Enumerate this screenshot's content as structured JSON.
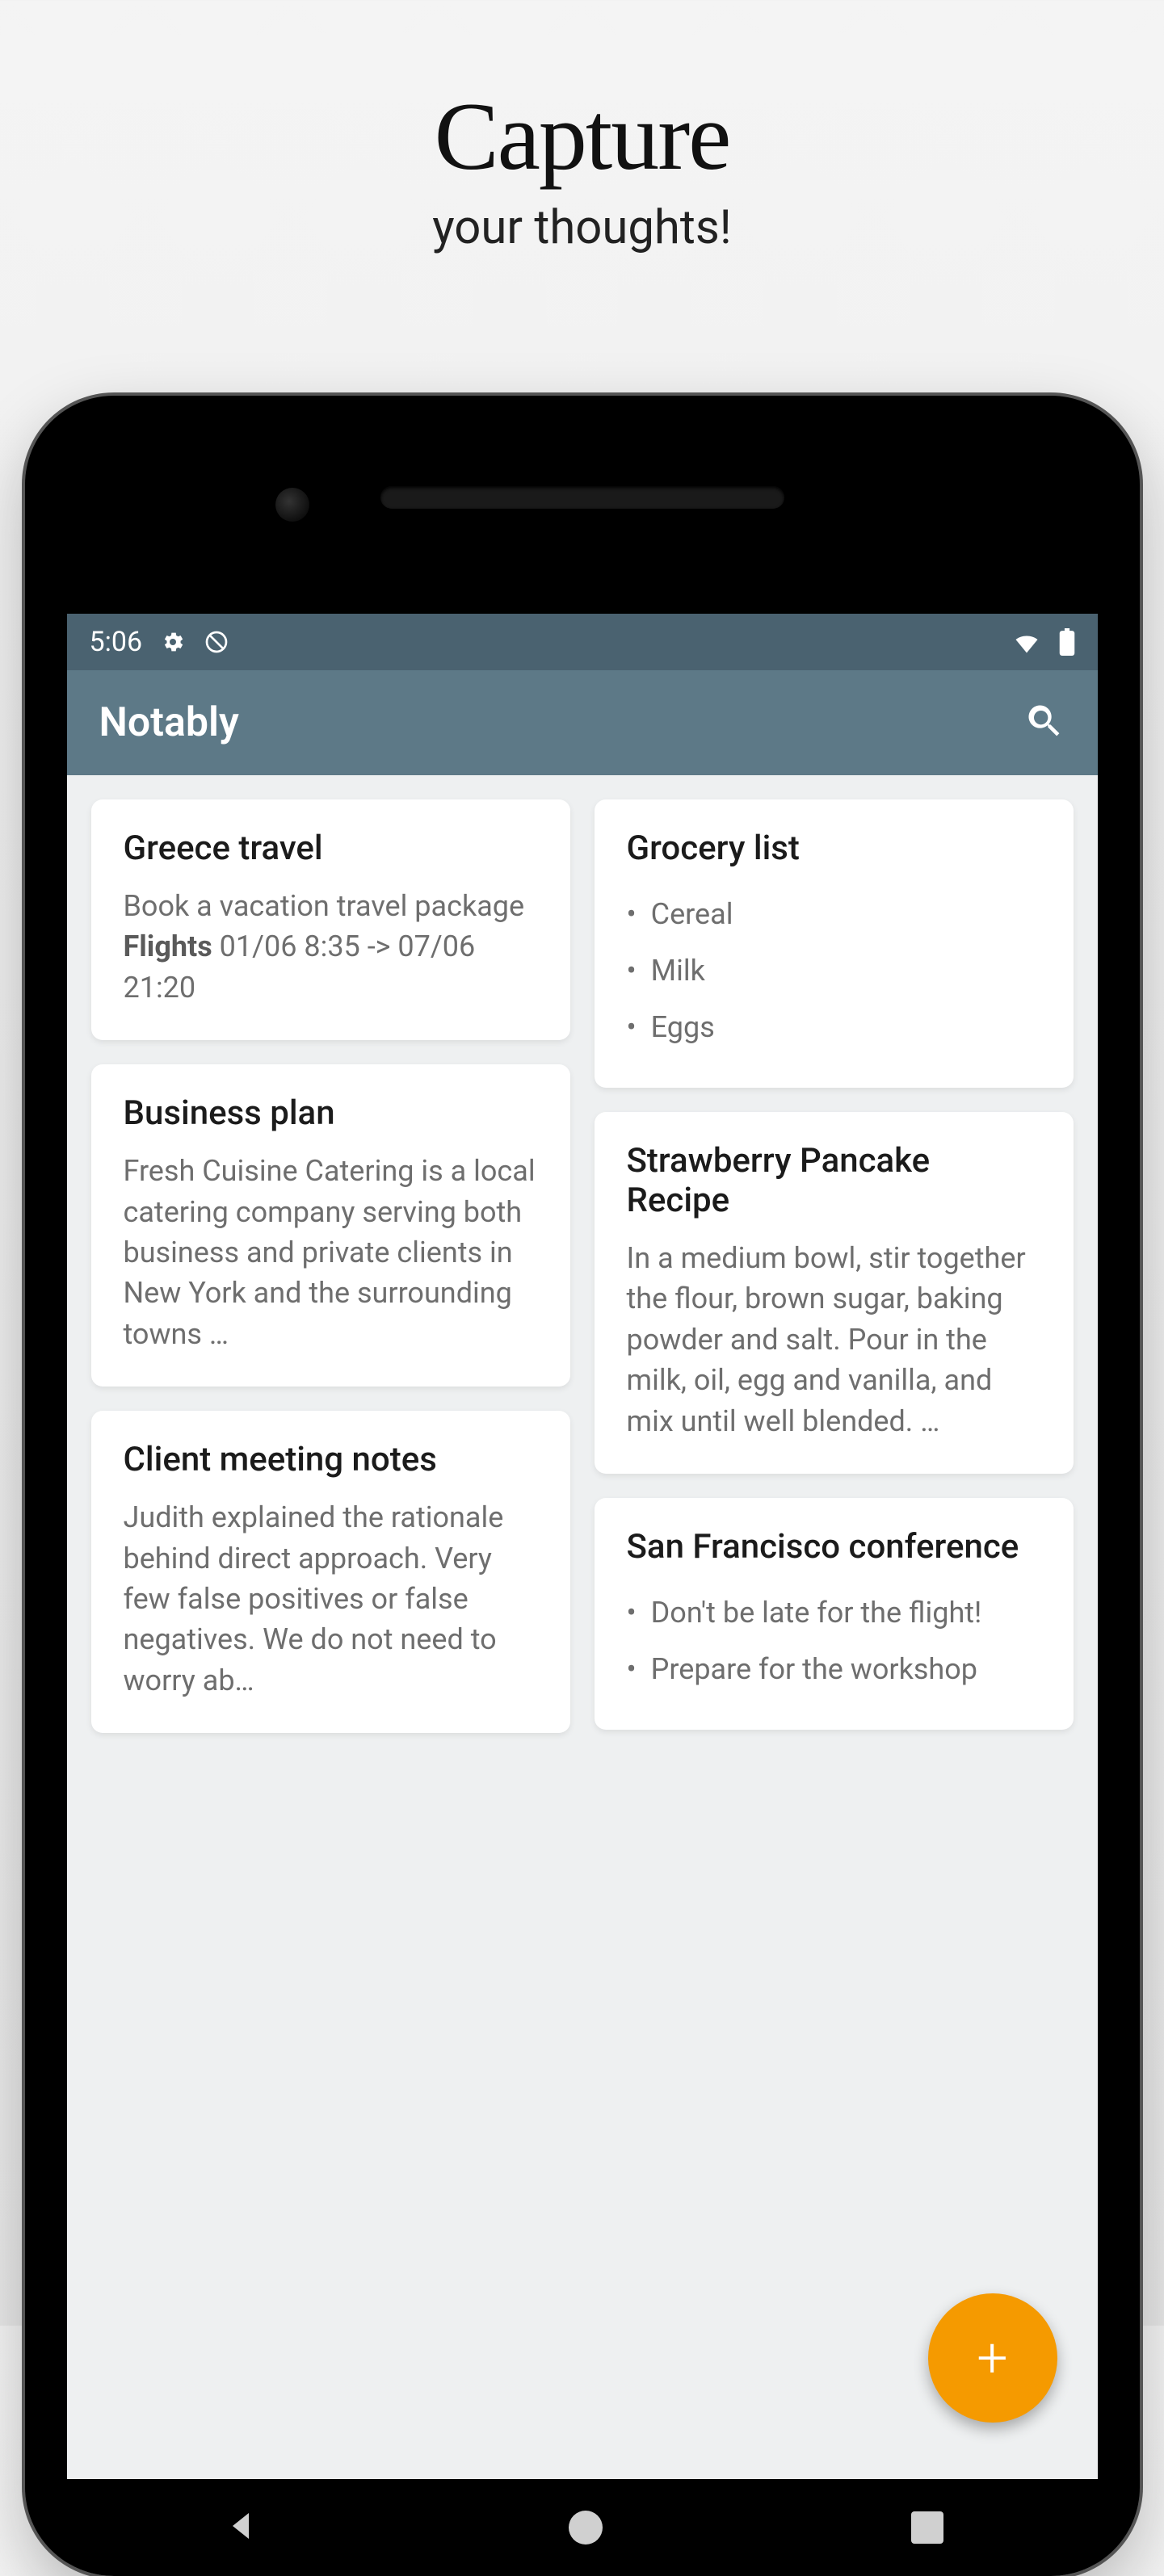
{
  "promo": {
    "title": "Capture",
    "subtitle": "your thoughts!"
  },
  "statusbar": {
    "time": "5:06"
  },
  "appbar": {
    "title": "Notably"
  },
  "columns": [
    [
      {
        "title": "Greece travel",
        "body_pre": "Book a vacation travel package",
        "body_bold": "Flights",
        "body_post": " 01/06 8:35 -> 07/06 21:20"
      },
      {
        "title": "Business plan",
        "body": "Fresh Cuisine Catering is a local catering company serving both business and private clients in New York and the surrounding towns …"
      },
      {
        "title": "Client meeting notes",
        "body": "Judith explained the rationale behind direct approach. Very few false positives or false negatives. We do not need to worry ab…"
      }
    ],
    [
      {
        "title": "Grocery list",
        "items": [
          "Cereal",
          "Milk",
          "Eggs"
        ]
      },
      {
        "title": "Strawberry Pancake Recipe",
        "body": "In a medium bowl, stir together the flour, brown sugar, baking powder and salt. Pour in the milk, oil, egg and vanilla, and mix until well blended. …"
      },
      {
        "title": "San Francisco conference",
        "items": [
          "Don't be late for the flight!",
          "Prepare for the workshop"
        ]
      }
    ]
  ],
  "fab": {
    "label": "+"
  }
}
